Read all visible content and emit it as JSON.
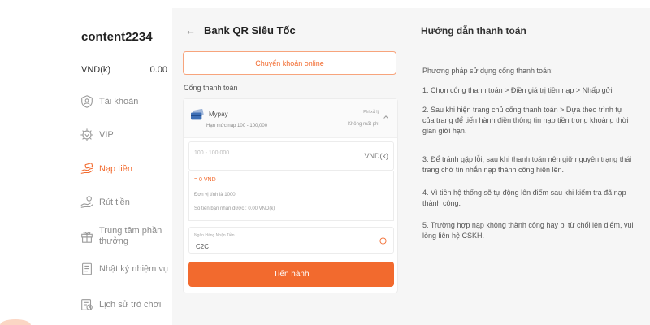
{
  "sidebar": {
    "username": "content2234",
    "balance_label": "VND(k)",
    "balance_value": "0.00",
    "items": [
      {
        "label": "Tài khoản",
        "icon": "shield-user-icon"
      },
      {
        "label": "VIP",
        "icon": "vip-badge-icon"
      },
      {
        "label": "Nạp tiền",
        "icon": "deposit-hand-icon",
        "active": true
      },
      {
        "label": "Rút tiền",
        "icon": "withdraw-hand-icon"
      },
      {
        "label": "Trung tâm phần thưởng",
        "line1": "Trung tâm phần",
        "line2": "thưởng",
        "icon": "gift-icon"
      },
      {
        "label": "Nhật ký nhiệm vụ",
        "icon": "task-log-icon"
      },
      {
        "label": "Lịch sử trò chơi",
        "icon": "game-history-icon"
      }
    ]
  },
  "form": {
    "back_icon": "back-arrow-icon",
    "title": "Bank QR Siêu Tốc",
    "online_tab": "Chuyển khoản online",
    "gateway_label": "Cổng thanh toán",
    "gateway": {
      "name": "Mypay",
      "limit": "Hạn mức nạp 100 - 100,000",
      "fee_label": "Phí xử lý",
      "fee_value": "Không mất phí"
    },
    "amount_placeholder": "100 - 100,000",
    "amount_unit": "VND(k)",
    "converted": "= 0 VND",
    "unit_note": "Đơn vị tính là 1000",
    "receive_note": "Số tiền bạn nhận được : 0.00 VND(k)",
    "bank_label": "Ngân Hàng Nhận Tiền",
    "bank_value": "C2C",
    "proceed": "Tiến hành"
  },
  "guide": {
    "title": "Hướng dẫn thanh toán",
    "intro": "Phương pháp sử dụng cổng thanh toán:",
    "steps": [
      "1. Chọn cổng thanh toán > Điền giá trị tiền nạp > Nhấp gửi",
      "2. Sau khi hiện trang chủ cổng thanh toán > Dựa theo trình tự của trang để tiến hành điền thông tin nạp tiền trong khoảng thời gian giới hạn.",
      "3. Để tránh gặp lỗi, sau khi thanh toán nên giữ nguyên trạng thái trang chờ tin nhắn nạp thành công hiện lên.",
      "4. Vì tiền hệ thống sẽ tự động lên điểm sau khi kiểm tra đã nạp thành công.",
      "5. Trường hợp nạp không thành công hay bị từ chối lên điểm, vui lòng liên hệ CSKH."
    ]
  },
  "colors": {
    "accent": "#f26a2e",
    "panel_bg": "#f6f6f6",
    "muted_text": "#8a8a8a"
  }
}
